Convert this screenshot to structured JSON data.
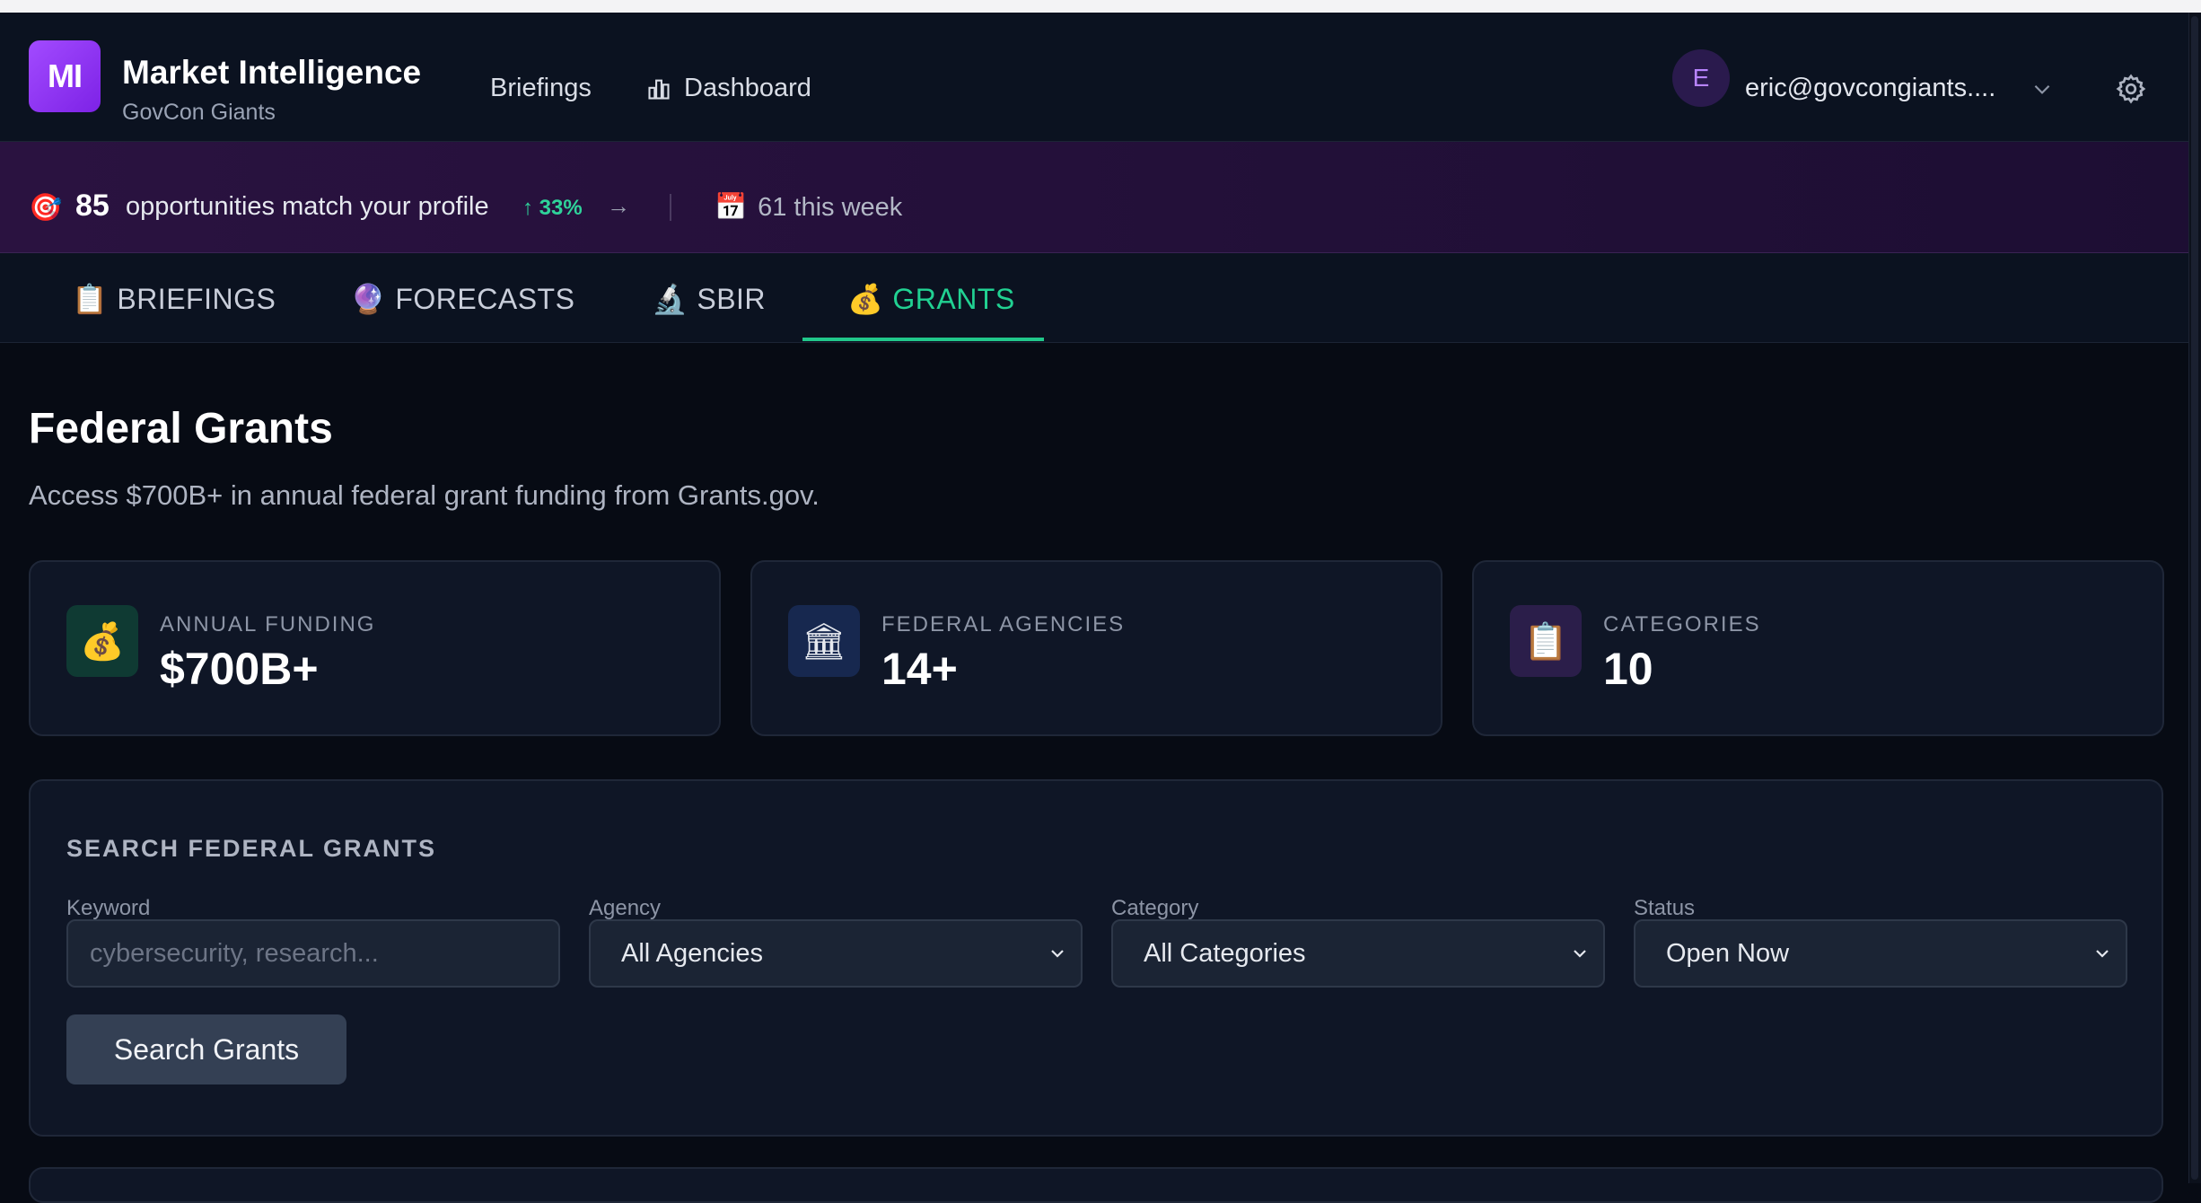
{
  "header": {
    "logo_text": "MI",
    "title": "Market Intelligence",
    "subtitle": "GovCon Giants",
    "nav": {
      "briefings": "Briefings",
      "dashboard": "Dashboard"
    },
    "user": {
      "initial": "E",
      "email": "eric@govcongiants...."
    }
  },
  "banner": {
    "icon": "🎯",
    "count": "85",
    "text": "opportunities match your profile",
    "trend": "↑ 33%",
    "arrow": "→",
    "week_icon": "📅",
    "week_text": "61 this week"
  },
  "tabs": [
    {
      "icon": "📋",
      "label": "BRIEFINGS"
    },
    {
      "icon": "🔮",
      "label": "FORECASTS"
    },
    {
      "icon": "🔬",
      "label": "SBIR"
    },
    {
      "icon": "💰",
      "label": "GRANTS"
    }
  ],
  "page": {
    "title": "Federal Grants",
    "subtitle": "Access $700B+ in annual federal grant funding from Grants.gov."
  },
  "stats": [
    {
      "icon": "💰",
      "label": "ANNUAL FUNDING",
      "value": "$700B+",
      "icon_bg": "#0f3a33"
    },
    {
      "icon": "🏛",
      "label": "FEDERAL AGENCIES",
      "value": "14+",
      "icon_bg": "#17284f"
    },
    {
      "icon": "📋",
      "label": "CATEGORIES",
      "value": "10",
      "icon_bg": "#2b1e4a"
    }
  ],
  "search": {
    "title": "SEARCH FEDERAL GRANTS",
    "keyword": {
      "label": "Keyword",
      "placeholder": "cybersecurity, research..."
    },
    "agency": {
      "label": "Agency",
      "value": "All Agencies"
    },
    "category": {
      "label": "Category",
      "value": "All Categories"
    },
    "status": {
      "label": "Status",
      "value": "Open Now"
    },
    "button": "Search Grants"
  },
  "colors": {
    "accent": "#21d192",
    "brand": "#9b3dff",
    "trend": "#2fd39a"
  }
}
